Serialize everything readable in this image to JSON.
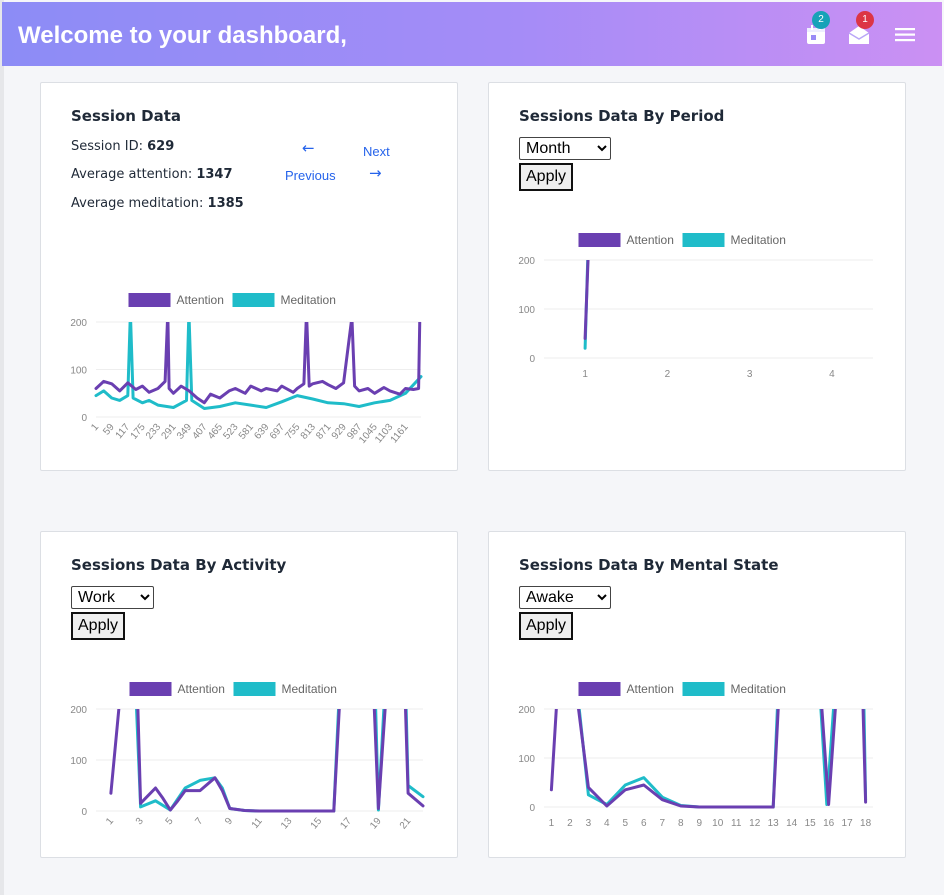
{
  "header": {
    "title": "Welcome to your dashboard,",
    "calendar_badge": "2",
    "mail_badge": "1"
  },
  "colors": {
    "attention": "#6a3fb1",
    "meditation": "#1fbcc9",
    "header_from": "#8c8cf6",
    "header_to": "#cb90f3"
  },
  "session_card": {
    "title": "Session Data",
    "session_id_label": "Session ID:",
    "session_id": "629",
    "attention_label": "Average attention:",
    "attention": "1347",
    "meditation_label": "Average meditation:",
    "meditation": "1385",
    "prev_label": "Previous",
    "next_label": "Next"
  },
  "period_card": {
    "title": "Sessions Data By Period",
    "select_value": "Month",
    "apply_label": "Apply"
  },
  "activity_card": {
    "title": "Sessions Data By Activity",
    "select_value": "Work",
    "apply_label": "Apply"
  },
  "mental_card": {
    "title": "Sessions Data By Mental State",
    "select_value": "Awake",
    "apply_label": "Apply"
  },
  "chart_data": [
    {
      "type": "line",
      "legend": [
        "Attention",
        "Meditation"
      ],
      "legend_position": "top",
      "yticks": [
        "0",
        "100",
        "200"
      ],
      "ylim": [
        0,
        200
      ],
      "xlim": [
        1,
        1219
      ],
      "xticks": [
        "1",
        "59",
        "117",
        "175",
        "233",
        "291",
        "349",
        "407",
        "465",
        "523",
        "581",
        "639",
        "697",
        "755",
        "813",
        "871",
        "929",
        "987",
        "1045",
        "1103",
        "1161"
      ],
      "series": [
        {
          "name": "Attention",
          "points": [
            [
              1,
              60
            ],
            [
              30,
              75
            ],
            [
              60,
              70
            ],
            [
              90,
              55
            ],
            [
              120,
              72
            ],
            [
              150,
              58
            ],
            [
              175,
              65
            ],
            [
              200,
              52
            ],
            [
              233,
              60
            ],
            [
              260,
              75
            ],
            [
              270,
              220
            ],
            [
              275,
              60
            ],
            [
              291,
              50
            ],
            [
              320,
              65
            ],
            [
              350,
              55
            ],
            [
              380,
              40
            ],
            [
              407,
              30
            ],
            [
              430,
              48
            ],
            [
              465,
              40
            ],
            [
              500,
              55
            ],
            [
              523,
              60
            ],
            [
              560,
              50
            ],
            [
              581,
              65
            ],
            [
              620,
              55
            ],
            [
              639,
              60
            ],
            [
              680,
              55
            ],
            [
              697,
              65
            ],
            [
              740,
              52
            ],
            [
              755,
              60
            ],
            [
              780,
              70
            ],
            [
              790,
              220
            ],
            [
              800,
              65
            ],
            [
              813,
              70
            ],
            [
              850,
              75
            ],
            [
              871,
              68
            ],
            [
              900,
              60
            ],
            [
              929,
              72
            ],
            [
              960,
              210
            ],
            [
              970,
              65
            ],
            [
              987,
              55
            ],
            [
              1020,
              60
            ],
            [
              1045,
              50
            ],
            [
              1080,
              62
            ],
            [
              1103,
              55
            ],
            [
              1140,
              48
            ],
            [
              1161,
              60
            ],
            [
              1190,
              58
            ],
            [
              1210,
              60
            ],
            [
              1215,
              220
            ]
          ]
        },
        {
          "name": "Meditation",
          "points": [
            [
              1,
              45
            ],
            [
              30,
              55
            ],
            [
              60,
              40
            ],
            [
              90,
              35
            ],
            [
              120,
              45
            ],
            [
              130,
              220
            ],
            [
              140,
              40
            ],
            [
              175,
              30
            ],
            [
              200,
              35
            ],
            [
              233,
              25
            ],
            [
              291,
              20
            ],
            [
              340,
              35
            ],
            [
              349,
              220
            ],
            [
              360,
              35
            ],
            [
              407,
              18
            ],
            [
              465,
              22
            ],
            [
              523,
              30
            ],
            [
              581,
              25
            ],
            [
              639,
              20
            ],
            [
              697,
              32
            ],
            [
              755,
              45
            ],
            [
              813,
              38
            ],
            [
              871,
              30
            ],
            [
              929,
              28
            ],
            [
              987,
              22
            ],
            [
              1045,
              30
            ],
            [
              1103,
              35
            ],
            [
              1161,
              50
            ],
            [
              1219,
              85
            ]
          ]
        }
      ]
    },
    {
      "type": "line",
      "legend": [
        "Attention",
        "Meditation"
      ],
      "legend_position": "top",
      "yticks": [
        "0",
        "100",
        "200"
      ],
      "ylim": [
        0,
        200
      ],
      "xticks": [
        "1",
        "2",
        "3",
        "4"
      ],
      "xlim": [
        0.5,
        4.5
      ],
      "series": [
        {
          "name": "Attention",
          "points": [
            [
              1.0,
              40
            ],
            [
              1.04,
              220
            ]
          ]
        },
        {
          "name": "Meditation",
          "points": [
            [
              1.0,
              20
            ],
            [
              1.035,
              220
            ]
          ]
        }
      ]
    },
    {
      "type": "line",
      "legend": [
        "Attention",
        "Meditation"
      ],
      "legend_position": "top",
      "yticks": [
        "0",
        "100",
        "200"
      ],
      "ylim": [
        0,
        200
      ],
      "xticks": [
        "1",
        "3",
        "5",
        "7",
        "9",
        "11",
        "13",
        "15",
        "17",
        "19",
        "21"
      ],
      "xlim": [
        0,
        22
      ],
      "series": [
        {
          "name": "Attention",
          "points": [
            [
              1,
              35
            ],
            [
              1.6,
              220
            ],
            [
              2.8,
              220
            ],
            [
              3,
              15
            ],
            [
              3.5,
              30
            ],
            [
              4,
              45
            ],
            [
              4.5,
              25
            ],
            [
              5,
              2
            ],
            [
              5.5,
              20
            ],
            [
              6,
              40
            ],
            [
              7,
              40
            ],
            [
              8,
              65
            ],
            [
              8.5,
              40
            ],
            [
              9,
              5
            ],
            [
              10,
              1
            ],
            [
              11,
              0
            ],
            [
              12,
              0
            ],
            [
              13,
              0
            ],
            [
              14,
              0
            ],
            [
              15,
              0
            ],
            [
              16,
              0
            ],
            [
              16.4,
              220
            ],
            [
              18.7,
              220
            ],
            [
              19,
              5
            ],
            [
              19.5,
              220
            ],
            [
              20.8,
              220
            ],
            [
              21,
              35
            ],
            [
              22,
              10
            ]
          ]
        },
        {
          "name": "Meditation",
          "points": [
            [
              2.7,
              220
            ],
            [
              3,
              8
            ],
            [
              4,
              20
            ],
            [
              5,
              2
            ],
            [
              6,
              45
            ],
            [
              7,
              60
            ],
            [
              8,
              65
            ],
            [
              8.5,
              45
            ],
            [
              9,
              5
            ],
            [
              10,
              1
            ],
            [
              11,
              0
            ],
            [
              12,
              0
            ],
            [
              13,
              0
            ],
            [
              14,
              0
            ],
            [
              15,
              0
            ],
            [
              16,
              0
            ],
            [
              16.35,
              220
            ],
            [
              18.8,
              220
            ],
            [
              19,
              2
            ],
            [
              19.4,
              220
            ],
            [
              20.85,
              220
            ],
            [
              21,
              50
            ],
            [
              22,
              28
            ]
          ]
        }
      ]
    },
    {
      "type": "line",
      "legend": [
        "Attention",
        "Meditation"
      ],
      "legend_position": "top",
      "yticks": [
        "0",
        "100",
        "200"
      ],
      "ylim": [
        0,
        200
      ],
      "xticks": [
        "1",
        "2",
        "3",
        "4",
        "5",
        "6",
        "7",
        "8",
        "9",
        "10",
        "11",
        "12",
        "13",
        "14",
        "15",
        "16",
        "17",
        "18"
      ],
      "xlim": [
        0.6,
        18.4
      ],
      "series": [
        {
          "name": "Attention",
          "points": [
            [
              1,
              35
            ],
            [
              1.3,
              220
            ],
            [
              2.4,
              220
            ],
            [
              3,
              40
            ],
            [
              4,
              2
            ],
            [
              5,
              35
            ],
            [
              6,
              45
            ],
            [
              7,
              15
            ],
            [
              8,
              2
            ],
            [
              9,
              0
            ],
            [
              10,
              0
            ],
            [
              11,
              0
            ],
            [
              12,
              0
            ],
            [
              13,
              0
            ],
            [
              13.3,
              220
            ],
            [
              15.6,
              220
            ],
            [
              16,
              5
            ],
            [
              16.4,
              220
            ],
            [
              17.85,
              220
            ],
            [
              18,
              10
            ]
          ]
        },
        {
          "name": "Meditation",
          "points": [
            [
              2.45,
              220
            ],
            [
              3,
              25
            ],
            [
              4,
              5
            ],
            [
              5,
              45
            ],
            [
              6,
              60
            ],
            [
              7,
              20
            ],
            [
              8,
              3
            ],
            [
              9,
              0
            ],
            [
              10,
              0
            ],
            [
              11,
              0
            ],
            [
              12,
              0
            ],
            [
              13,
              0
            ],
            [
              13.25,
              220
            ],
            [
              15.55,
              220
            ],
            [
              15.9,
              5
            ],
            [
              16.3,
              220
            ],
            [
              17.9,
              220
            ],
            [
              18,
              15
            ]
          ]
        }
      ]
    }
  ]
}
